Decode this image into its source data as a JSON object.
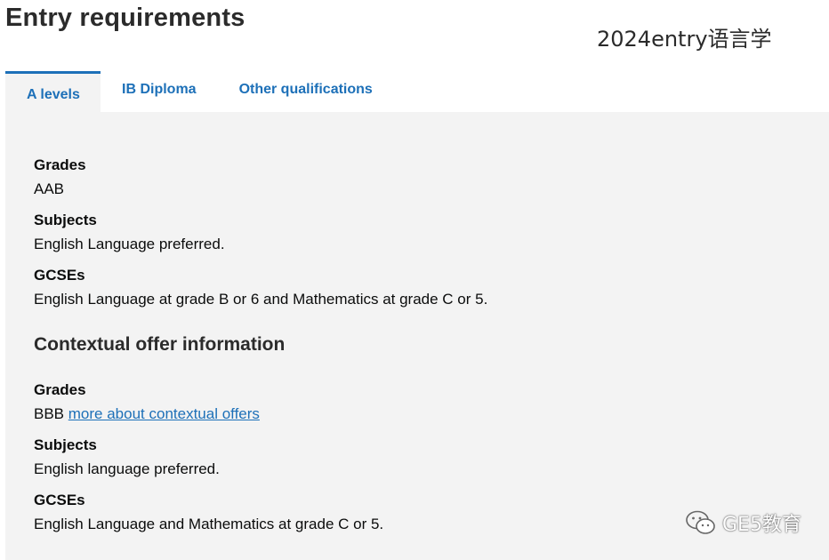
{
  "page": {
    "title": "Entry requirements",
    "overlay_caption": "2024entry语言学"
  },
  "tabs": [
    {
      "label": "A levels",
      "active": true
    },
    {
      "label": "IB Diploma",
      "active": false
    },
    {
      "label": "Other qualifications",
      "active": false
    }
  ],
  "standard": {
    "grades_label": "Grades",
    "grades_value": "AAB",
    "subjects_label": "Subjects",
    "subjects_value": "English Language preferred.",
    "gcses_label": "GCSEs",
    "gcses_value": "English Language at grade B or 6 and Mathematics at grade C or 5."
  },
  "contextual": {
    "heading": "Contextual offer information",
    "grades_label": "Grades",
    "grades_value": "BBB",
    "grades_link": "more about contextual offers",
    "subjects_label": "Subjects",
    "subjects_value": "English language preferred.",
    "gcses_label": "GCSEs",
    "gcses_value": "English Language and Mathematics at grade C or 5."
  },
  "watermark": {
    "text": "GE5教育",
    "icon": "wechat-icon"
  },
  "colors": {
    "link": "#1d70b8",
    "panel_background": "#f3f3f3",
    "text": "#0b0c0c"
  }
}
